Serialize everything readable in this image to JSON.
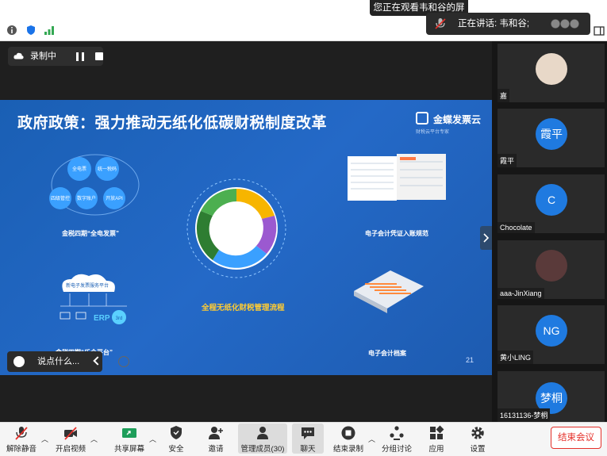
{
  "banner": {
    "viewing": "您正在观看韦和谷的屏幕"
  },
  "speaking": {
    "label": "正在讲话: 韦和谷;"
  },
  "recording": {
    "label": "录制中"
  },
  "slide": {
    "title": "政府政策：强力推动无纸化低碳财税制度改革",
    "brand": "金蝶发票云",
    "brand_sub": "财税云平台专家",
    "captions": [
      "金税四期“全电发票”",
      "电子会计凭证入账规范",
      "全程无纸化财税管理流程",
      "电子会计档案",
      "金税四期“乐企平台”"
    ],
    "bubbles": [
      "全电票",
      "统一税码",
      "四级管控",
      "数字账户",
      "开放API"
    ],
    "cloud_label": "新电子发票服务平台",
    "erp": "ERP",
    "erp_3rd": "3rd",
    "page": "21"
  },
  "chat": {
    "placeholder": "说点什么..."
  },
  "participants": [
    {
      "name": "嘉",
      "avatar": ""
    },
    {
      "name": "霞平",
      "avatar": "霞平"
    },
    {
      "name": "Chocolate",
      "avatar": "C"
    },
    {
      "name": "aaa-JinXiang",
      "avatar": ""
    },
    {
      "name": "黄小LING",
      "avatar": "NG"
    },
    {
      "name": "16131136-梦桐",
      "avatar": "梦桐"
    }
  ],
  "toolbar": {
    "mute": "解除静音",
    "video": "开启视频",
    "share": "共享屏幕",
    "security": "安全",
    "invite": "邀请",
    "members": "管理成员(30)",
    "chat": "聊天",
    "record": "结束录制",
    "breakout": "分组讨论",
    "apps": "应用",
    "settings": "设置",
    "end": "结束会议"
  },
  "colors": {
    "accent": "#2469c7",
    "danger": "#e5302a",
    "caption_highlight": "#ffcc33"
  }
}
